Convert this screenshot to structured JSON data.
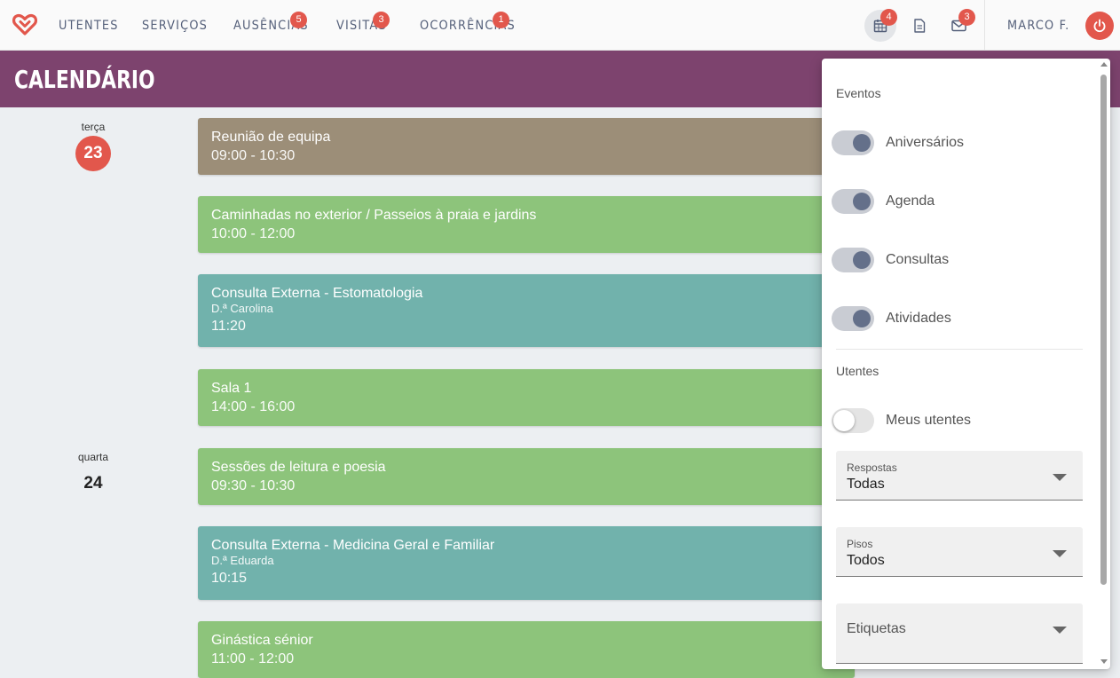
{
  "nav": {
    "items": [
      {
        "label": "UTENTES",
        "badge": null
      },
      {
        "label": "SERVIÇOS",
        "badge": null
      },
      {
        "label": "AUSÊNCIAS",
        "badge": "5"
      },
      {
        "label": "VISITAS",
        "badge": "3"
      },
      {
        "label": "OCORRÊNCIAS",
        "badge": "1"
      }
    ],
    "calendar_badge": "4",
    "messages_badge": "3",
    "user_name": "MARCO F."
  },
  "header": {
    "title": "CALENDÁRIO"
  },
  "days": [
    {
      "weekday": "terça",
      "number": "23",
      "today": true
    },
    {
      "weekday": "quarta",
      "number": "24",
      "today": false
    }
  ],
  "events": [
    {
      "title": "Reunião de equipa",
      "time": "09:00 - 10:30",
      "color": "#9c8e78"
    },
    {
      "title": "Caminhadas no exterior / Passeios à praia e jardins",
      "time": "10:00 - 12:00",
      "color": "#8dc47b"
    },
    {
      "title": "Consulta Externa - Estomatologia",
      "subtitle": "D.ª Carolina",
      "time": "11:20",
      "color": "#71b2ac"
    },
    {
      "title": "Sala 1",
      "time": "14:00 - 16:00",
      "color": "#8dc47b"
    },
    {
      "title": "Sessões de leitura e poesia",
      "time": "09:30 - 10:30",
      "color": "#8dc47b"
    },
    {
      "title": "Consulta Externa - Medicina Geral e Familiar",
      "subtitle": "D.ª Eduarda",
      "time": "10:15",
      "color": "#71b2ac"
    },
    {
      "title": "Ginástica sénior",
      "time": "11:00 - 12:00",
      "color": "#8dc47b"
    }
  ],
  "filters": {
    "events_section": "Eventos",
    "event_toggles": [
      {
        "label": "Aniversários",
        "on": true
      },
      {
        "label": "Agenda",
        "on": true
      },
      {
        "label": "Consultas",
        "on": true
      },
      {
        "label": "Atividades",
        "on": true
      }
    ],
    "residents_section": "Utentes",
    "my_residents": {
      "label": "Meus utentes",
      "on": false
    },
    "responses": {
      "label": "Respostas",
      "value": "Todas"
    },
    "floors": {
      "label": "Pisos",
      "value": "Todos"
    },
    "tags": {
      "label": "Etiquetas"
    }
  },
  "colors": {
    "accent": "#e2574c",
    "header": "#7d436e",
    "nav_text": "#55607a"
  }
}
